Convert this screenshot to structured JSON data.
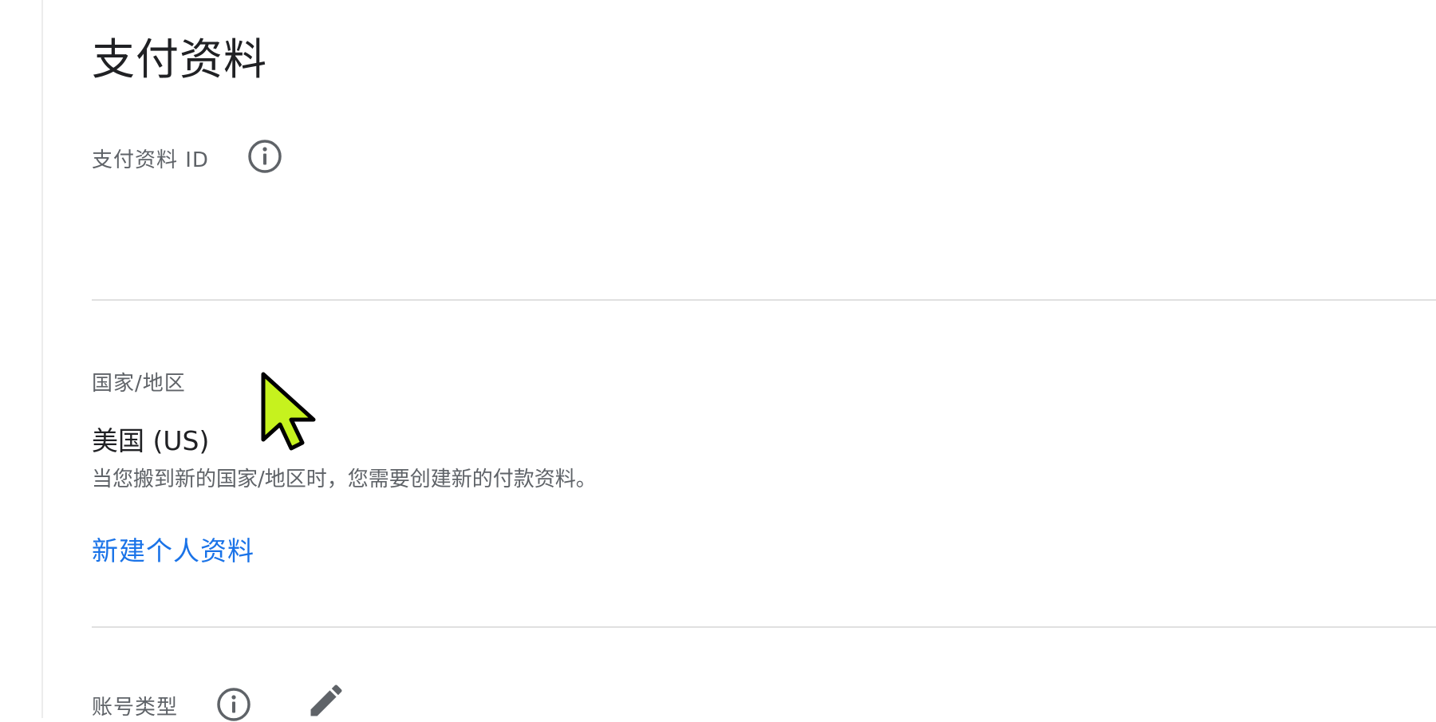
{
  "page": {
    "title": "支付资料"
  },
  "fields": {
    "payment_profile_id": {
      "label": "支付资料 ID",
      "value": ""
    },
    "country": {
      "label": "国家/地区",
      "value": "美国 (US)",
      "helper": "当您搬到新的国家/地区时，您需要创建新的付款资料。",
      "create_link": "新建个人资料"
    },
    "account_type": {
      "label": "账号类型"
    }
  },
  "colors": {
    "link": "#1a73e8",
    "cursor_fill": "#c6f21e"
  },
  "icons": {
    "info": "info-icon",
    "edit": "pencil-icon",
    "cursor": "mouse-cursor-icon"
  }
}
